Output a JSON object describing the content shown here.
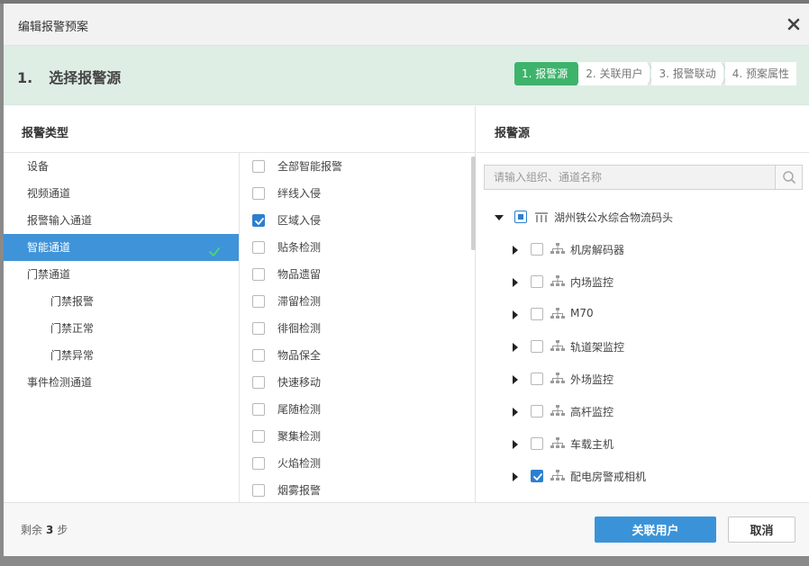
{
  "dialog": {
    "title": "编辑报警预案",
    "close_icon": "close-icon"
  },
  "stepbar": {
    "step_number": "1.",
    "step_title": "选择报警源",
    "steps": [
      {
        "label": "1. 报警源",
        "active": true
      },
      {
        "label": "2. 关联用户",
        "active": false
      },
      {
        "label": "3. 报警联动",
        "active": false
      },
      {
        "label": "4. 预案属性",
        "active": false
      }
    ]
  },
  "left_panel": {
    "header": "报警类型",
    "types": [
      {
        "label": "设备",
        "sub": false,
        "active": false
      },
      {
        "label": "视频通道",
        "sub": false,
        "active": false
      },
      {
        "label": "报警输入通道",
        "sub": false,
        "active": false
      },
      {
        "label": "智能通道",
        "sub": false,
        "active": true
      },
      {
        "label": "门禁通道",
        "sub": false,
        "active": false
      },
      {
        "label": "门禁报警",
        "sub": true,
        "active": false
      },
      {
        "label": "门禁正常",
        "sub": true,
        "active": false
      },
      {
        "label": "门禁异常",
        "sub": true,
        "active": false
      },
      {
        "label": "事件检测通道",
        "sub": false,
        "active": false
      }
    ],
    "subtypes": [
      {
        "label": "全部智能报警",
        "checked": false
      },
      {
        "label": "绊线入侵",
        "checked": false
      },
      {
        "label": "区域入侵",
        "checked": true
      },
      {
        "label": "贴条检测",
        "checked": false
      },
      {
        "label": "物品遗留",
        "checked": false
      },
      {
        "label": "滞留检测",
        "checked": false
      },
      {
        "label": "徘徊检测",
        "checked": false
      },
      {
        "label": "物品保全",
        "checked": false
      },
      {
        "label": "快速移动",
        "checked": false
      },
      {
        "label": "尾随检测",
        "checked": false
      },
      {
        "label": "聚集检测",
        "checked": false
      },
      {
        "label": "火焰检测",
        "checked": false
      },
      {
        "label": "烟雾报警",
        "checked": false
      }
    ]
  },
  "right_panel": {
    "header": "报警源",
    "search": {
      "placeholder": "请输入组织、通道名称",
      "value": ""
    },
    "tree": {
      "root": {
        "label": "湖州铁公水综合物流码头",
        "expanded": true,
        "state": "partial"
      },
      "children": [
        {
          "label": "机房解码器",
          "checked": false
        },
        {
          "label": "内场监控",
          "checked": false
        },
        {
          "label": "M70",
          "checked": false
        },
        {
          "label": "轨道架监控",
          "checked": false
        },
        {
          "label": "外场监控",
          "checked": false
        },
        {
          "label": "高杆监控",
          "checked": false
        },
        {
          "label": "车载主机",
          "checked": false
        },
        {
          "label": "配电房警戒相机",
          "checked": true
        }
      ]
    }
  },
  "footer": {
    "remain_prefix": "剩余",
    "remain_count": "3",
    "remain_suffix": "步",
    "primary_label": "关联用户",
    "cancel_label": "取消"
  },
  "colors": {
    "accent": "#3a93d8",
    "step_active": "#3db36b",
    "stepbar_bg": "#deeee4"
  }
}
